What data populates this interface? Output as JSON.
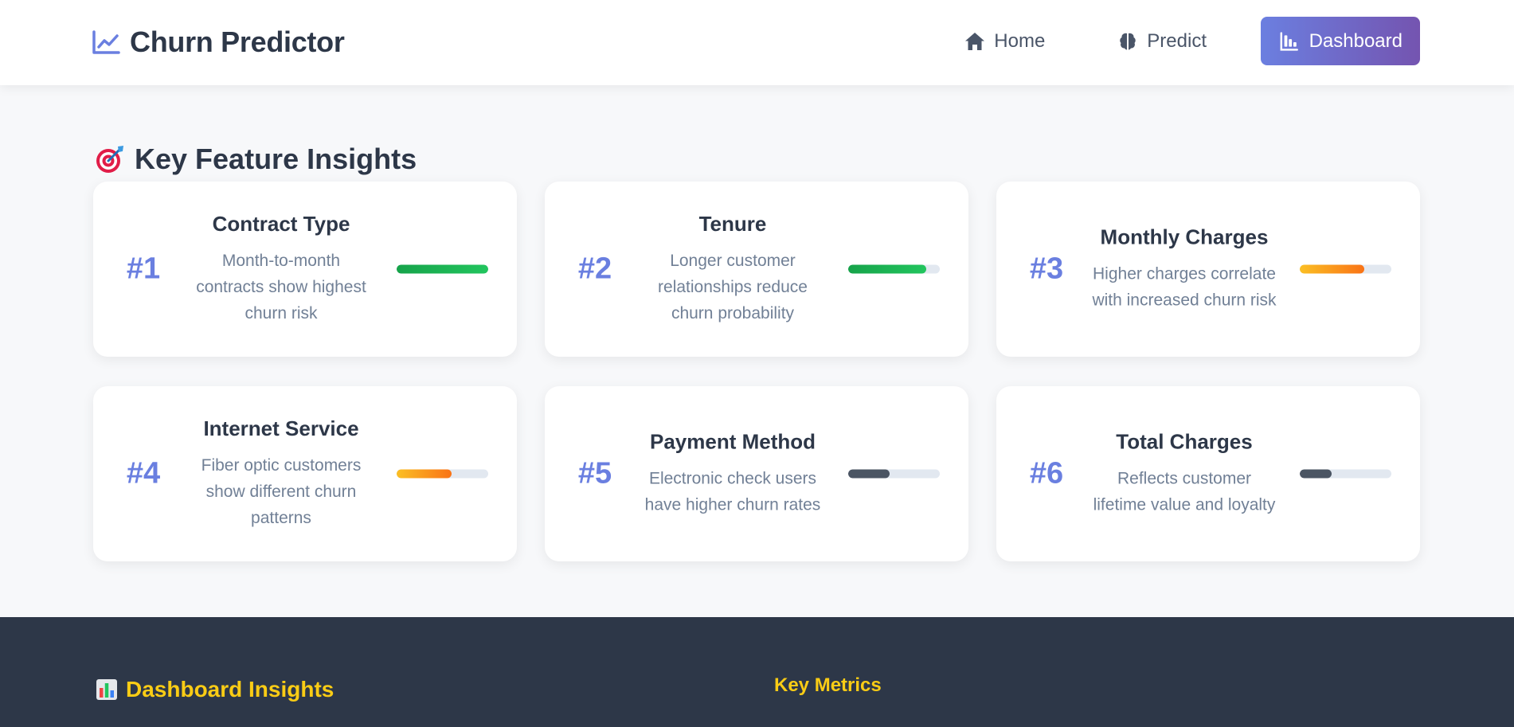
{
  "app": {
    "title": "Churn Predictor",
    "icon": "chart-line-icon",
    "accent_color": "#6a7fe0"
  },
  "nav": {
    "items": [
      {
        "label": "Home",
        "icon": "home-icon",
        "active": false
      },
      {
        "label": "Predict",
        "icon": "brain-icon",
        "active": false
      },
      {
        "label": "Dashboard",
        "icon": "chart-bar-icon",
        "active": true
      }
    ]
  },
  "insights": {
    "title": "Key Feature Insights",
    "icon": "target-icon",
    "cards": [
      {
        "rank": "#1",
        "title": "Contract Type",
        "description": "Month-to-month contracts show highest churn risk",
        "importance": 1.0,
        "color": "#22c55e"
      },
      {
        "rank": "#2",
        "title": "Tenure",
        "description": "Longer customer relationships reduce churn probability",
        "importance": 0.85,
        "color": "#22c55e"
      },
      {
        "rank": "#3",
        "title": "Monthly Charges",
        "description": "Higher charges correlate with increased churn risk",
        "importance": 0.7,
        "color": "#f97316"
      },
      {
        "rank": "#4",
        "title": "Internet Service",
        "description": "Fiber optic customers show different churn patterns",
        "importance": 0.6,
        "color": "#f97316"
      },
      {
        "rank": "#5",
        "title": "Payment Method",
        "description": "Electronic check users have higher churn rates",
        "importance": 0.45,
        "color": "#4b5563"
      },
      {
        "rank": "#6",
        "title": "Total Charges",
        "description": "Reflects customer lifetime value and loyalty",
        "importance": 0.35,
        "color": "#4b5563"
      }
    ]
  },
  "footer": {
    "title": "Dashboard Insights",
    "icon": "bar-chart-icon",
    "metrics_heading": "Key Metrics",
    "heading_color": "#facc15"
  }
}
